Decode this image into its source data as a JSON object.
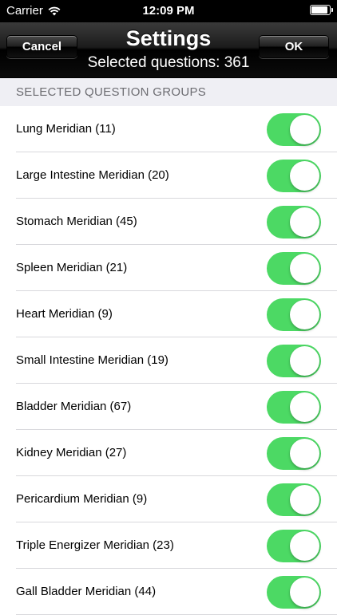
{
  "status": {
    "carrier": "Carrier",
    "time": "12:09 PM"
  },
  "nav": {
    "title": "Settings",
    "subtitle": "Selected questions: 361",
    "cancel_label": "Cancel",
    "ok_label": "OK"
  },
  "section": {
    "header": "SELECTED QUESTION GROUPS"
  },
  "colors": {
    "toggle_on": "#4cd964"
  },
  "groups": [
    {
      "label": "Lung Meridian (11)",
      "on": true
    },
    {
      "label": "Large Intestine Meridian (20)",
      "on": true
    },
    {
      "label": "Stomach Meridian (45)",
      "on": true
    },
    {
      "label": "Spleen Meridian (21)",
      "on": true
    },
    {
      "label": "Heart Meridian (9)",
      "on": true
    },
    {
      "label": "Small Intestine Meridian (19)",
      "on": true
    },
    {
      "label": "Bladder Meridian (67)",
      "on": true
    },
    {
      "label": "Kidney Meridian (27)",
      "on": true
    },
    {
      "label": "Pericardium Meridian (9)",
      "on": true
    },
    {
      "label": "Triple Energizer Meridian (23)",
      "on": true
    },
    {
      "label": "Gall Bladder Meridian (44)",
      "on": true
    }
  ]
}
